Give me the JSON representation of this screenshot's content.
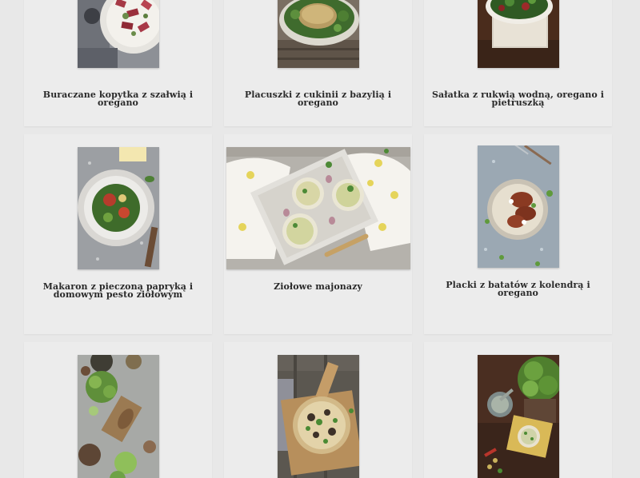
{
  "recipes": [
    {
      "title": "Buraczane kopytka z szałwią i oregano",
      "image": "beetroot-gnocchi-photo"
    },
    {
      "title": "Placuszki z cukinii z bazylią i oregano",
      "image": "zucchini-fritters-photo"
    },
    {
      "title": "Sałatka z rukwią wodną, oregano i pietruszką",
      "image": "watercress-salad-photo"
    },
    {
      "title": "Makaron z pieczoną papryką i domowym pesto ziołowym",
      "image": "pasta-pesto-photo"
    },
    {
      "title": "Ziołowe majonazy",
      "image": "herb-mayonnaise-photo"
    },
    {
      "title": "Placki z batatów z kolendrą i oregano",
      "image": "sweet-potato-pancakes-photo"
    },
    {
      "title": "",
      "image": "herbs-board-photo"
    },
    {
      "title": "",
      "image": "flatbread-tart-photo"
    },
    {
      "title": "",
      "image": "herb-pot-photo"
    }
  ]
}
